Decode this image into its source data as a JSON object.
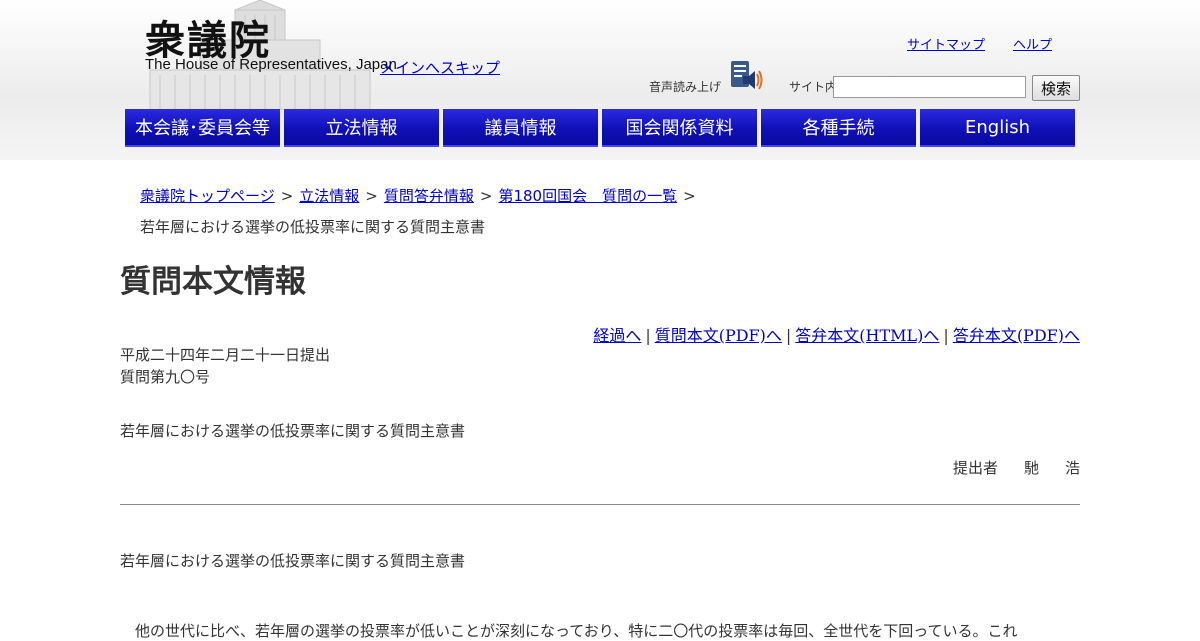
{
  "header": {
    "logo_kanji": "衆議院",
    "logo_en": "The House of Representatives, Japan",
    "skip_link": "メインへスキップ",
    "top_links": [
      "サイトマップ",
      "ヘルプ"
    ],
    "voice_label": "音声読み上げ",
    "search_label": "サイト内",
    "search_button": "検索",
    "search_value": ""
  },
  "nav": {
    "items": [
      "本会議･委員会等",
      "立法情報",
      "議員情報",
      "国会関係資料",
      "各種手続",
      "English"
    ]
  },
  "breadcrumb": {
    "items": [
      "衆議院トップページ",
      "立法情報",
      "質問答弁情報",
      "第180回国会　質問の一覧"
    ],
    "separator": ">",
    "current": "若年層における選挙の低投票率に関する質問主意書"
  },
  "page": {
    "title": "質問本文情報",
    "doc_links": [
      "経過へ",
      "質問本文(PDF)へ",
      "答弁本文(HTML)へ",
      "答弁本文(PDF)へ"
    ],
    "doc_link_separator": "|",
    "submitted_date": "平成二十四年二月二十一日提出",
    "question_number": "質問第九〇号",
    "question_title": "若年層における選挙の低投票率に関する質問主意書",
    "submitter_label": "提出者",
    "submitter_name": [
      "馳",
      "浩"
    ],
    "body_title": "若年層における選挙の低投票率に関する質問主意書",
    "body_text": "　他の世代に比べ、若年層の選挙の投票率が低いことが深刻になっており、特に二〇代の投票率は毎回、全世代を下回っている。これ"
  },
  "colors": {
    "nav_bg": "#1414c0",
    "link": "#0000cc",
    "text": "#333333"
  }
}
